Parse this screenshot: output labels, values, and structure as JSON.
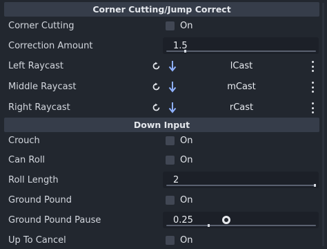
{
  "sections": [
    {
      "title": "Corner Cutting/Jump Correct"
    },
    {
      "title": "Down Input"
    }
  ],
  "rows": {
    "corner_cutting": {
      "label": "Corner Cutting",
      "value": "On",
      "checked": false
    },
    "correction_amount": {
      "label": "Correction Amount",
      "value": "1.5",
      "slider_fraction": 0.12
    },
    "left_raycast": {
      "label": "Left Raycast",
      "node": "lCast"
    },
    "middle_raycast": {
      "label": "Middle Raycast",
      "node": "mCast"
    },
    "right_raycast": {
      "label": "Right Raycast",
      "node": "rCast"
    },
    "crouch": {
      "label": "Crouch",
      "value": "On",
      "checked": false
    },
    "can_roll": {
      "label": "Can Roll",
      "value": "On",
      "checked": false
    },
    "roll_length": {
      "label": "Roll Length",
      "value": "2",
      "slider_fraction": 1.0
    },
    "ground_pound": {
      "label": "Ground Pound",
      "value": "On",
      "checked": false
    },
    "ground_pound_pause": {
      "label": "Ground Pound Pause",
      "value": "0.25",
      "slider_fraction": 0.28
    },
    "up_to_cancel": {
      "label": "Up To Cancel",
      "value": "On",
      "checked": false
    }
  },
  "icons": {
    "reset": "reload-icon",
    "assign": "arrow-down-icon",
    "menu": "vertical-dots-icon"
  },
  "colors": {
    "background": "#22272f",
    "header": "#363d4a",
    "field": "#1c2028",
    "accent_arrow": "#8fb1ff"
  }
}
